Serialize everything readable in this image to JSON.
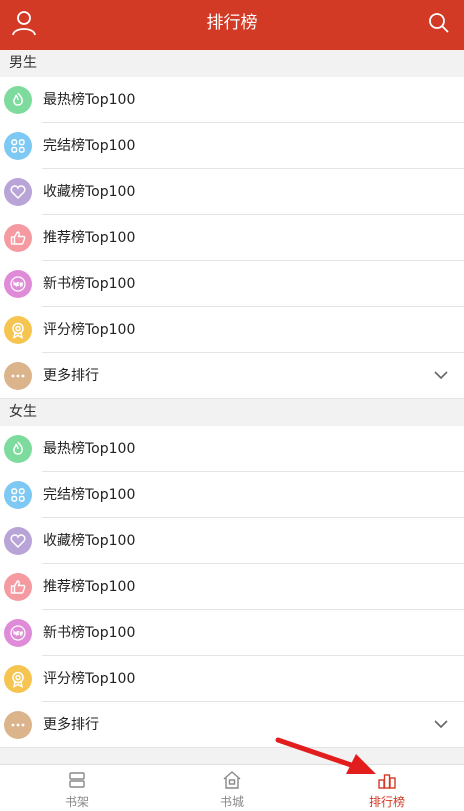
{
  "header": {
    "title": "排行榜",
    "left_icon": "user-icon",
    "right_icon": "search-icon"
  },
  "colors": {
    "header_bg": "#d23a26",
    "hot": "#7ddc9d",
    "finished": "#7ec8f4",
    "collect": "#b8a4d6",
    "recommend": "#f59aa1",
    "new": "#e08bd8",
    "score": "#f6c450",
    "more": "#dcb48c",
    "arrow": "#e11d1d"
  },
  "sections": [
    {
      "title": "男生",
      "items": [
        {
          "label": "最热榜Top100",
          "icon": "flame-icon"
        },
        {
          "label": "完结榜Top100",
          "icon": "grid-icon"
        },
        {
          "label": "收藏榜Top100",
          "icon": "heart-icon"
        },
        {
          "label": "推荐榜Top100",
          "icon": "thumbs-up-icon"
        },
        {
          "label": "新书榜Top100",
          "icon": "new-badge-icon"
        },
        {
          "label": "评分榜Top100",
          "icon": "medal-icon"
        },
        {
          "label": "更多排行",
          "icon": "ellipsis-icon"
        }
      ]
    },
    {
      "title": "女生",
      "items": [
        {
          "label": "最热榜Top100",
          "icon": "flame-icon"
        },
        {
          "label": "完结榜Top100",
          "icon": "grid-icon"
        },
        {
          "label": "收藏榜Top100",
          "icon": "heart-icon"
        },
        {
          "label": "推荐榜Top100",
          "icon": "thumbs-up-icon"
        },
        {
          "label": "新书榜Top100",
          "icon": "new-badge-icon"
        },
        {
          "label": "评分榜Top100",
          "icon": "medal-icon"
        },
        {
          "label": "更多排行",
          "icon": "ellipsis-icon"
        }
      ]
    }
  ],
  "tabbar": {
    "tabs": [
      {
        "label": "书架",
        "icon": "bookshelf-icon",
        "active": false
      },
      {
        "label": "书城",
        "icon": "store-icon",
        "active": false
      },
      {
        "label": "排行榜",
        "icon": "ranking-icon",
        "active": true
      }
    ]
  }
}
